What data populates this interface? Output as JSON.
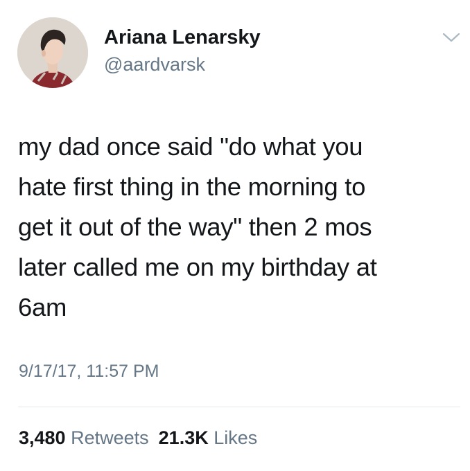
{
  "author": {
    "display_name": "Ariana Lenarsky",
    "handle": "@aardvarsk",
    "avatar_icon": "profile-photo"
  },
  "menu": {
    "icon": "chevron-down-icon"
  },
  "tweet": {
    "lines": [
      "my dad once said \"do what you",
      "hate first thing in the morning to",
      "get it out of the way\" then 2 mos",
      "later called me on my birthday at",
      "6am"
    ],
    "timestamp": "9/17/17, 11:57 PM"
  },
  "stats": {
    "retweets_count": "3,480",
    "retweets_label": "Retweets",
    "likes_count": "21.3K",
    "likes_label": "Likes"
  },
  "colors": {
    "text": "#14171a",
    "secondary": "#657786",
    "divider": "#e1e8ed"
  }
}
